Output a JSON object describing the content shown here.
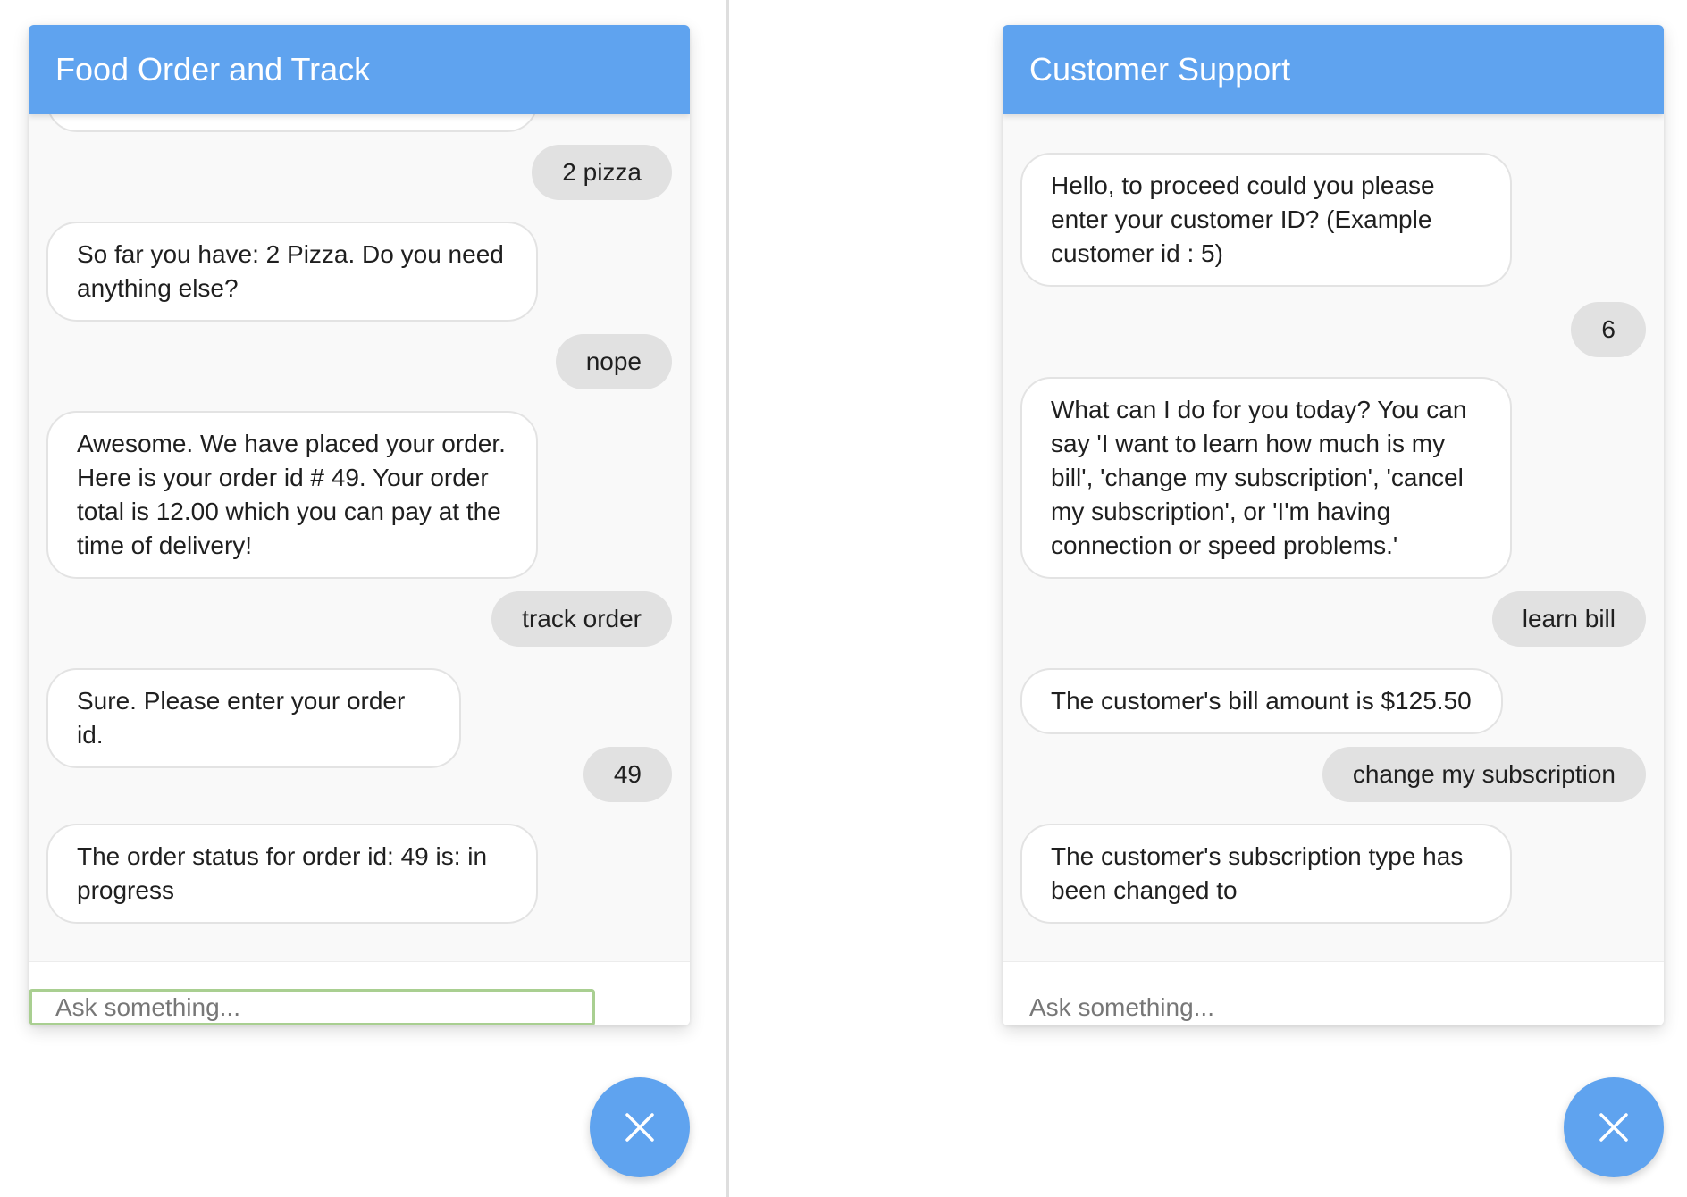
{
  "colors": {
    "accent": "#5fa3ef",
    "bot_bubble": "#ffffff",
    "user_bubble": "#e1e1e1",
    "input_focus_border": "#a9cf91"
  },
  "left_chat": {
    "title": "Food Order and Track",
    "messages": [
      {
        "from": "user",
        "text": "2 pizza"
      },
      {
        "from": "bot",
        "text": "So far you have: 2 Pizza. Do you need anything else?"
      },
      {
        "from": "user",
        "text": "nope"
      },
      {
        "from": "bot",
        "text": "Awesome. We have placed your order. Here is your order id # 49. Your order total is 12.00 which you can pay at the time of delivery!"
      },
      {
        "from": "user",
        "text": "track order"
      },
      {
        "from": "bot",
        "text": "Sure. Please enter your order id."
      },
      {
        "from": "user",
        "text": "49"
      },
      {
        "from": "bot",
        "text": "The order status for order id: 49 is: in progress"
      }
    ],
    "input_placeholder": "Ask something...",
    "close_icon": "close-icon"
  },
  "right_chat": {
    "title": "Customer Support",
    "messages": [
      {
        "from": "bot",
        "text": "Hello, to proceed could you please enter your customer ID? (Example customer id : 5)"
      },
      {
        "from": "user",
        "text": "6"
      },
      {
        "from": "bot",
        "text": "What can I do for you today? You can say 'I want to learn how much is my bill', 'change my subscription', 'cancel my subscription', or 'I'm having connection or speed problems.'"
      },
      {
        "from": "user",
        "text": "learn bill"
      },
      {
        "from": "bot",
        "text": "The customer's bill amount is $125.50"
      },
      {
        "from": "user",
        "text": "change my subscription"
      },
      {
        "from": "bot",
        "text": "The customer's subscription type has been changed to"
      }
    ],
    "input_placeholder": "Ask something...",
    "close_icon": "close-icon"
  }
}
